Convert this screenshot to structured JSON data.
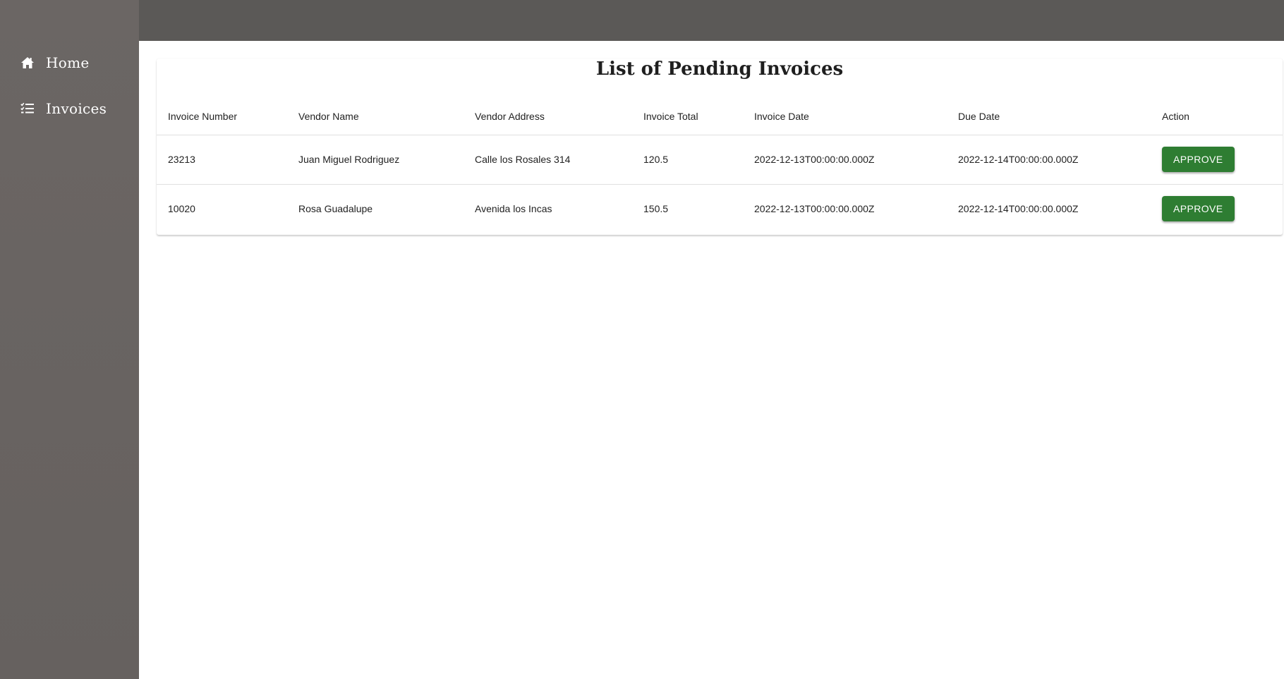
{
  "sidebar": {
    "items": [
      {
        "label": "Home",
        "icon": "home-icon"
      },
      {
        "label": "Invoices",
        "icon": "checklist-icon"
      }
    ]
  },
  "main": {
    "title": "List of Pending Invoices",
    "table": {
      "headers": [
        "Invoice Number",
        "Vendor Name",
        "Vendor Address",
        "Invoice Total",
        "Invoice Date",
        "Due Date",
        "Action"
      ],
      "rows": [
        {
          "invoice_number": "23213",
          "vendor_name": "Juan Miguel Rodriguez",
          "vendor_address": "Calle los Rosales 314",
          "invoice_total": "120.5",
          "invoice_date": "2022-12-13T00:00:00.000Z",
          "due_date": "2022-12-14T00:00:00.000Z",
          "action_label": "APPROVE"
        },
        {
          "invoice_number": "10020",
          "vendor_name": "Rosa Guadalupe",
          "vendor_address": "Avenida los Incas",
          "invoice_total": "150.5",
          "invoice_date": "2022-12-13T00:00:00.000Z",
          "due_date": "2022-12-14T00:00:00.000Z",
          "action_label": "APPROVE"
        }
      ]
    }
  },
  "colors": {
    "sidebar_bg": "#68635f",
    "topbar_bg": "#5b5957",
    "approve_button": "#2e7d32"
  }
}
